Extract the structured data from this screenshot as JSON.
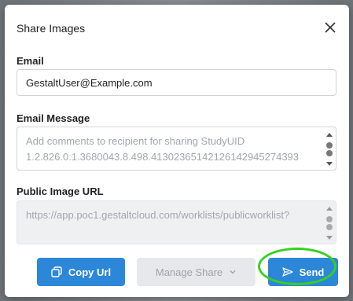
{
  "dialog": {
    "title": "Share Images",
    "close_icon": "close-icon"
  },
  "email": {
    "label": "Email",
    "value": "GestaltUser@Example.com"
  },
  "email_message": {
    "label": "Email Message",
    "placeholder": "Add comments to recipient for sharing StudyUID 1.2.826.0.1.3680043.8.498.41302365142126142945274393"
  },
  "public_url": {
    "label": "Public Image URL",
    "placeholder": "https://app.poc1.gestaltcloud.com/worklists/publicworklist?"
  },
  "buttons": {
    "copy_url": "Copy Url",
    "manage_share": "Manage Share",
    "send": "Send"
  },
  "colors": {
    "primary": "#2d87d8",
    "highlight": "#35d11f"
  }
}
